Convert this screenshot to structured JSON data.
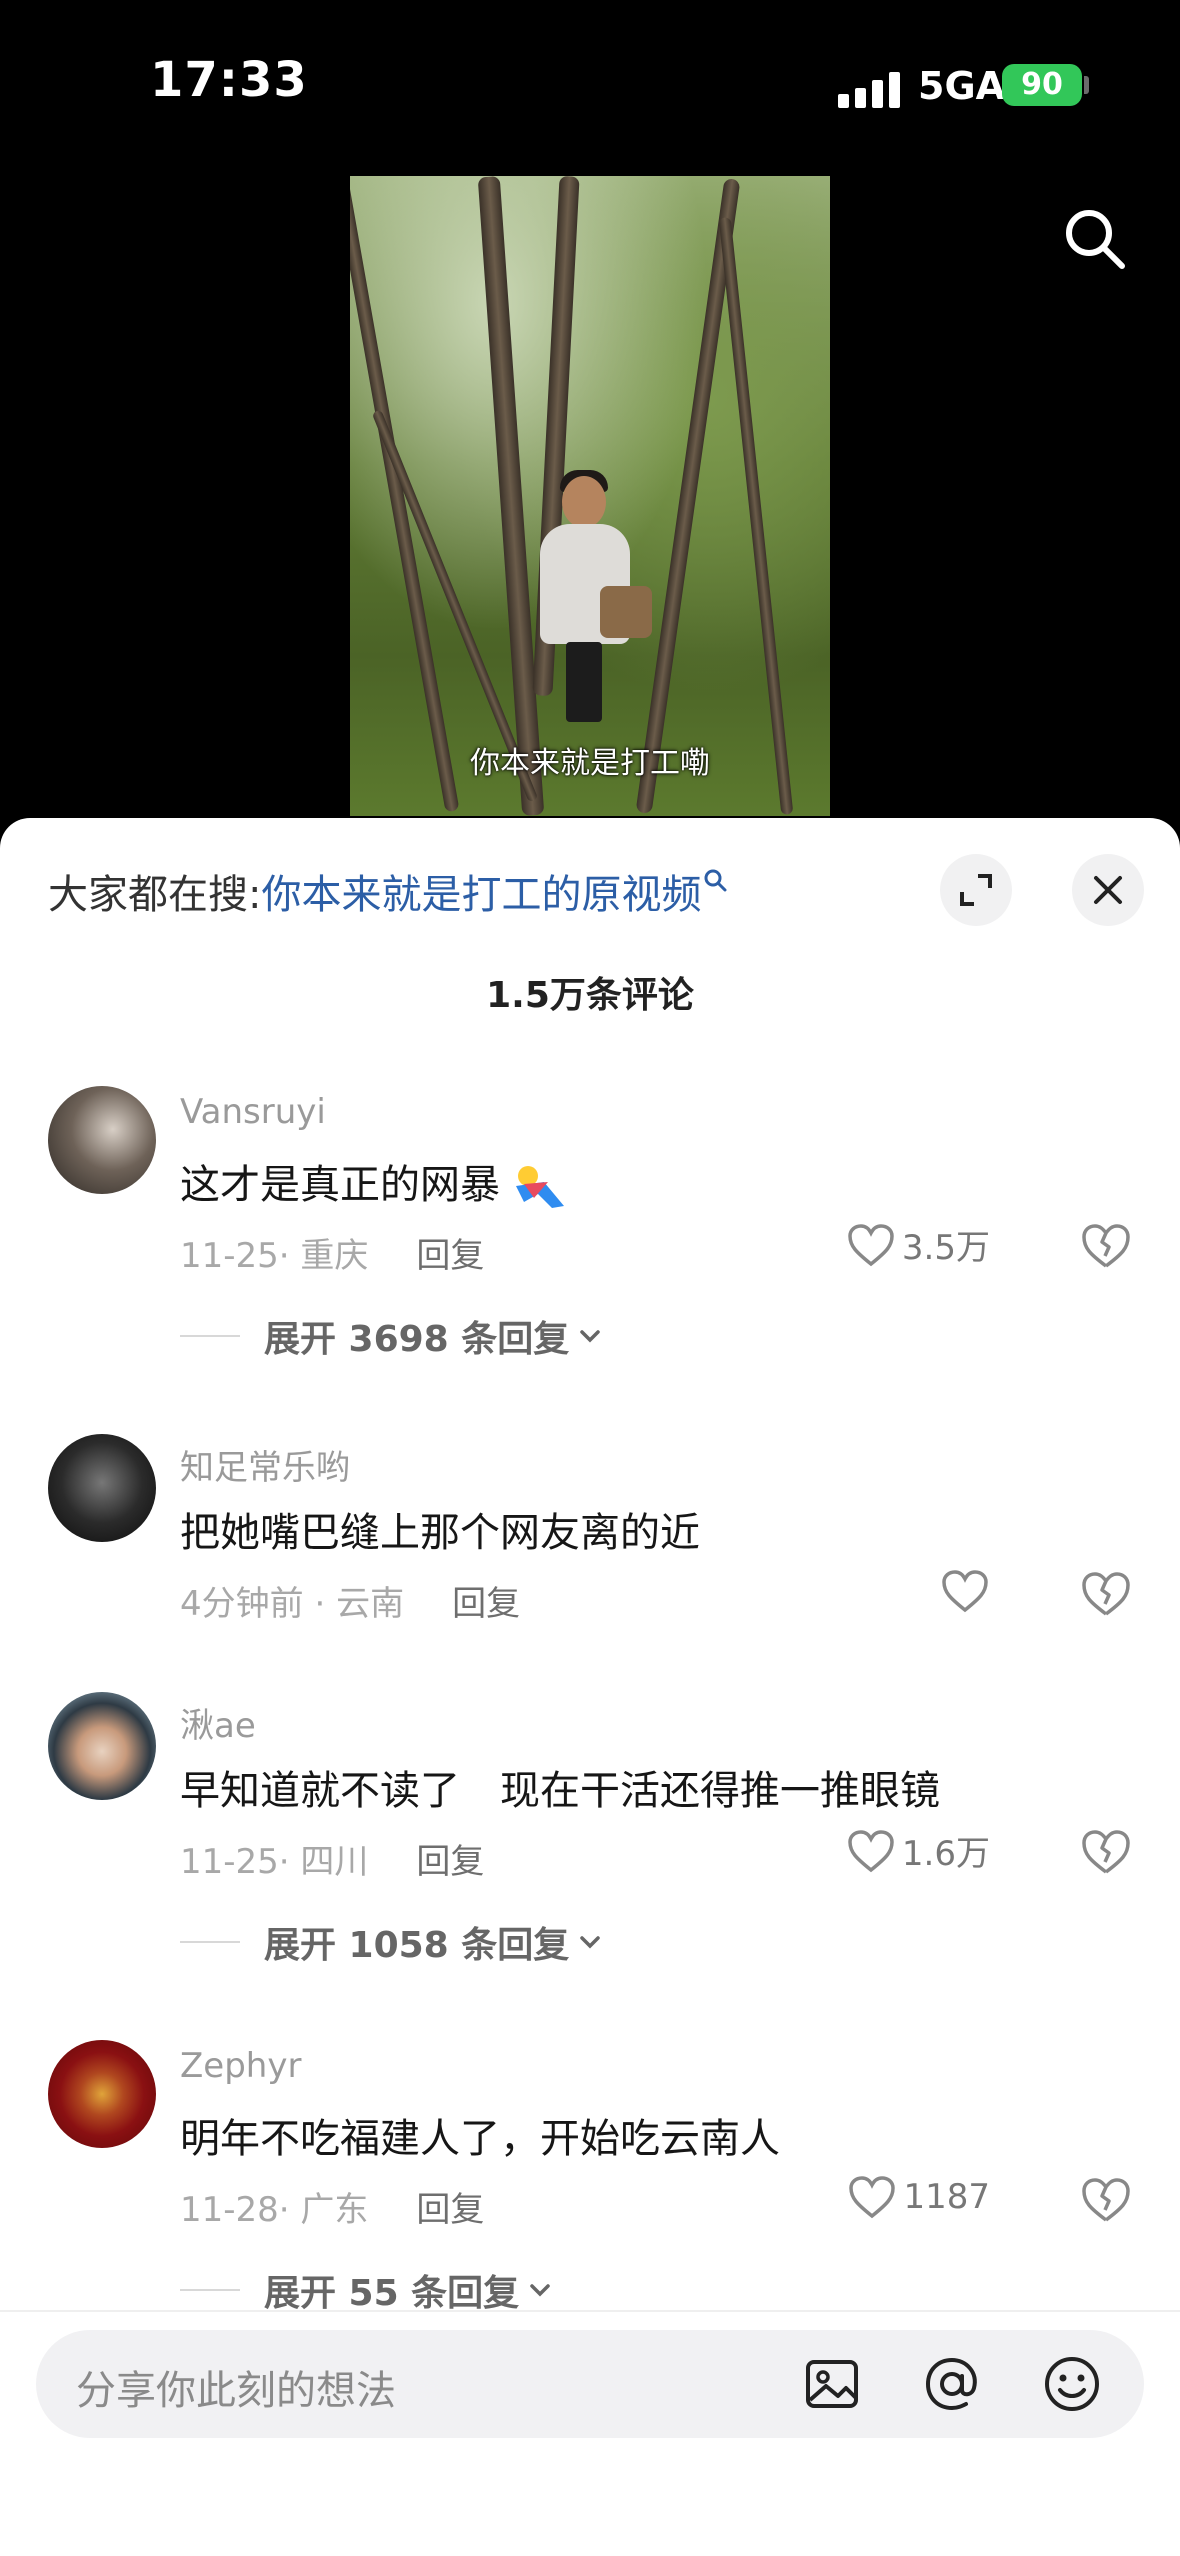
{
  "status_bar": {
    "time": "17:33",
    "network": "5GA",
    "battery": "90"
  },
  "video": {
    "caption": "你本来就是打工嘞"
  },
  "sheet": {
    "trending_prefix": "大家都在搜:",
    "trending_query": "你本来就是打工的原视频",
    "comment_count_title": "1.5万条评论"
  },
  "comments": [
    {
      "username": "Vansruyi",
      "text": "这才是真正的网暴",
      "date": "11-25",
      "location": "重庆",
      "reply_label": "回复",
      "likes": "3.5万",
      "expand_label": "展开 3698 条回复"
    },
    {
      "username": "知足常乐哟",
      "text": "把她嘴巴缝上那个网友离的近",
      "date": "4分钟前",
      "location": "云南",
      "reply_label": "回复",
      "likes": "",
      "expand_label": ""
    },
    {
      "username": "湫ae",
      "text": "早知道就不读了　现在干活还得推一推眼镜",
      "date": "11-25",
      "location": "四川",
      "reply_label": "回复",
      "likes": "1.6万",
      "expand_label": "展开 1058 条回复"
    },
    {
      "username": "Zephyr",
      "text": "明年不吃福建人了，开始吃云南人",
      "date": "11-28",
      "location": "广东",
      "reply_label": "回复",
      "likes": "1187",
      "expand_label": "展开 55 条回复"
    }
  ],
  "input": {
    "placeholder": "分享你此刻的想法"
  },
  "icons": [
    "search-icon",
    "search-small-icon",
    "expand-icon",
    "close-icon",
    "heart-icon",
    "broken-heart-icon",
    "chevron-down-icon",
    "image-icon",
    "at-icon",
    "emoji-icon"
  ],
  "colors": {
    "accent_link": "#2c5ea6",
    "battery_green": "#32c759"
  }
}
